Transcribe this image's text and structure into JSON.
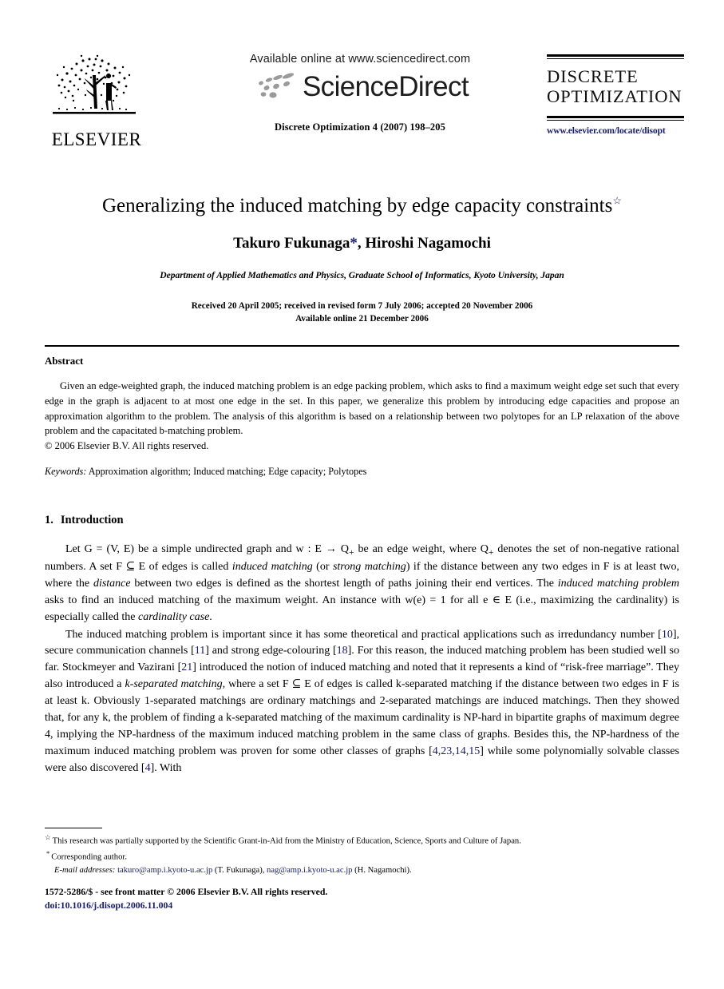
{
  "header": {
    "publisher_logo_word": "ELSEVIER",
    "available_online": "Available online at www.sciencedirect.com",
    "sciencedirect_word": "ScienceDirect",
    "journal_reference": "Discrete Optimization 4 (2007) 198–205",
    "nameplate_title": "DISCRETE\nOPTIMIZATION",
    "nameplate_url": "www.elsevier.com/locate/disopt"
  },
  "title_block": {
    "title": "Generalizing the induced matching by edge capacity constraints",
    "title_footnote_mark": "☆",
    "authors_part1": "Takuro Fukunaga",
    "author_mark": "*",
    "authors_part2": ", Hiroshi Nagamochi",
    "affiliation": "Department of Applied Mathematics and Physics, Graduate School of Informatics, Kyoto University, Japan",
    "history_line1": "Received 20 April 2005; received in revised form 7 July 2006; accepted 20 November 2006",
    "history_line2": "Available online 21 December 2006"
  },
  "abstract": {
    "heading": "Abstract",
    "text": "Given an edge-weighted graph, the induced matching problem is an edge packing problem, which asks to find a maximum weight edge set such that every edge in the graph is adjacent to at most one edge in the set. In this paper, we generalize this problem by introducing edge capacities and propose an approximation algorithm to the problem. The analysis of this algorithm is based on a relationship between two polytopes for an LP relaxation of the above problem and the capacitated b-matching problem.",
    "copyright": "© 2006 Elsevier B.V. All rights reserved.",
    "keywords_label": "Keywords:",
    "keywords_value": "Approximation algorithm; Induced matching; Edge capacity; Polytopes"
  },
  "section": {
    "number": "1.",
    "name": "Introduction"
  },
  "paragraphs": {
    "p1_a": "Let G = (V, E) be a simple undirected graph and w : E → Q",
    "p1_sub": "+",
    "p1_b": " be an edge weight, where Q",
    "p1_c": " denotes the set of non-negative rational numbers. A set F ⊆ E of edges is called ",
    "p1_em1": "induced matching",
    "p1_d": " (or ",
    "p1_em2": "strong matching",
    "p1_e": ") if the distance between any two edges in F is at least two, where the ",
    "p1_em3": "distance",
    "p1_f": " between two edges is defined as the shortest length of paths joining their end vertices. The ",
    "p1_em4": "induced matching problem",
    "p1_g": " asks to find an induced matching of the maximum weight. An instance with w(e) = 1 for all e ∈ E (i.e., maximizing the cardinality) is especially called the ",
    "p1_em5": "cardinality case",
    "p1_h": ".",
    "p2_a": "The induced matching problem is important since it has some theoretical and practical applications such as irredundancy number [",
    "p2_c1": "10",
    "p2_b": "], secure communication channels [",
    "p2_c2": "11",
    "p2_c": "] and strong edge-colouring [",
    "p2_c3": "18",
    "p2_d": "]. For this reason, the induced matching problem has been studied well so far. Stockmeyer and Vazirani [",
    "p2_c4": "21",
    "p2_e": "] introduced the notion of induced matching and noted that it represents a kind of “risk-free marriage”. They also introduced a ",
    "p2_em1": "k-separated matching",
    "p2_f": ", where a set F ⊆ E of edges is called k-separated matching if the distance between two edges in F is at least k. Obviously 1-separated matchings are ordinary matchings and 2-separated matchings are induced matchings. Then they showed that, for any k, the problem of finding a k-separated matching of the maximum cardinality is NP-hard in bipartite graphs of maximum degree 4, implying the NP-hardness of the maximum induced matching problem in the same class of graphs. Besides this, the NP-hardness of the maximum induced matching problem was proven for some other classes of graphs [",
    "p2_c5": "4,23,14,15",
    "p2_g": "] while some polynomially solvable classes were also discovered [",
    "p2_c6": "4",
    "p2_h": "]. With"
  },
  "footnotes": {
    "grant_mark": "☆",
    "grant_text": "This research was partially supported by the Scientific Grant-in-Aid from the Ministry of Education, Science, Sports and Culture of Japan.",
    "corresponding_mark": "*",
    "corresponding_text": "Corresponding author.",
    "email_label": "E-mail addresses:",
    "email1": "takuro@amp.i.kyoto-u.ac.jp",
    "email1_name": "(T. Fukunaga),",
    "email2": "nag@amp.i.kyoto-u.ac.jp",
    "email2_name": "(H. Nagamochi)."
  },
  "imprint": {
    "line1": "1572-5286/$ - see front matter © 2006 Elsevier B.V. All rights reserved.",
    "doi": "doi:10.1016/j.disopt.2006.11.004"
  },
  "colors": {
    "link": "#151c6b",
    "text": "#000000",
    "logo_gray": "#9a9a9a"
  }
}
